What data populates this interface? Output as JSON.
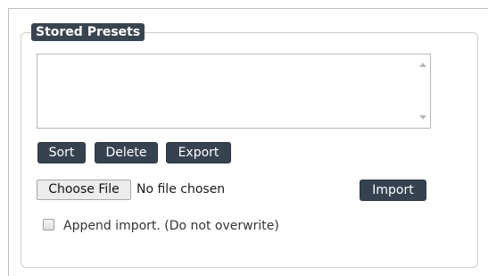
{
  "panel": {
    "legend": "Stored Presets"
  },
  "preset_list": {
    "items": []
  },
  "buttons": {
    "sort": "Sort",
    "delete": "Delete",
    "export": "Export",
    "import": "Import"
  },
  "file_input": {
    "button_label": "Choose File",
    "status": "No file chosen"
  },
  "append_option": {
    "label": "Append import. (Do not overwrite)",
    "checked": false
  }
}
